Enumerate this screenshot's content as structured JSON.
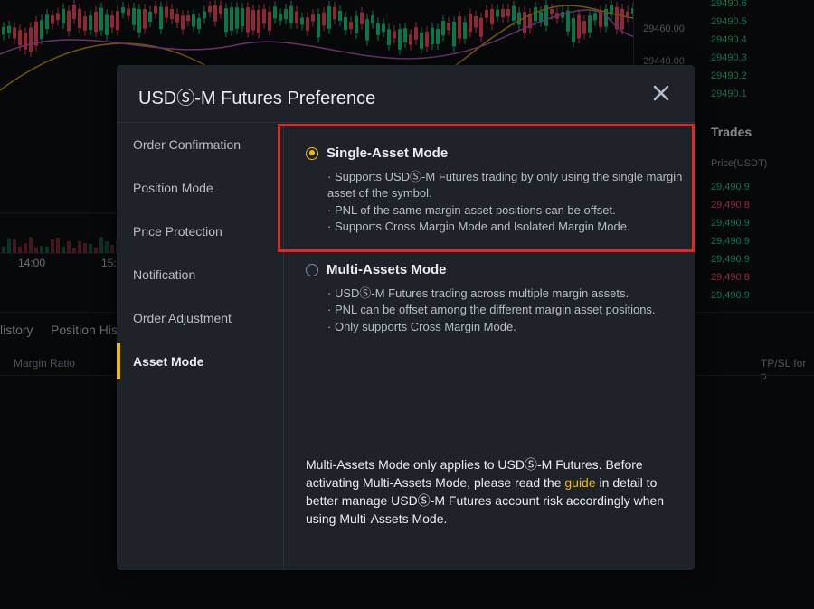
{
  "background": {
    "price_axis": [
      "29460.00",
      "29440.00"
    ],
    "orderbook_prices": [
      "29490.6",
      "29490.5",
      "29490.4",
      "29490.3",
      "29490.2",
      "29490.1"
    ],
    "trades": {
      "title": "Trades",
      "header": "Price(USDT)",
      "rows": [
        {
          "price": "29,490.9",
          "color": "#0ecb81"
        },
        {
          "price": "29,490.8",
          "color": "#f6465d"
        },
        {
          "price": "29,490.9",
          "color": "#0ecb81"
        },
        {
          "price": "29,490.9",
          "color": "#0ecb81"
        },
        {
          "price": "29,490.9",
          "color": "#0ecb81"
        },
        {
          "price": "29,490.8",
          "color": "#f6465d"
        },
        {
          "price": "29,490.9",
          "color": "#0ecb81"
        }
      ]
    },
    "time_labels": [
      "14:00",
      "15:"
    ],
    "bottom_tabs": [
      "listory",
      "Position His"
    ],
    "bottom_columns": {
      "margin_ratio": "Margin Ratio",
      "tpsl": "TP/SL for p"
    }
  },
  "modal": {
    "title": "USDⓈ-M Futures Preference",
    "close_icon": "close-icon",
    "nav": [
      {
        "label": "Order Confirmation",
        "active": false
      },
      {
        "label": "Position Mode",
        "active": false
      },
      {
        "label": "Price Protection",
        "active": false
      },
      {
        "label": "Notification",
        "active": false
      },
      {
        "label": "Order Adjustment",
        "active": false
      },
      {
        "label": "Asset Mode",
        "active": true
      }
    ],
    "options": [
      {
        "title": "Single-Asset Mode",
        "selected": true,
        "bullets": [
          "Supports USDⓈ-M Futures trading by only using the single margin asset of the symbol.",
          "PNL of the same margin asset positions can be offset.",
          "Supports Cross Margin Mode and Isolated Margin Mode."
        ]
      },
      {
        "title": "Multi-Assets Mode",
        "selected": false,
        "bullets": [
          "USDⓈ-M Futures trading across multiple margin assets.",
          "PNL can be offset among the different margin asset positions.",
          "Only supports Cross Margin Mode."
        ]
      }
    ],
    "note": {
      "before": "Multi-Assets Mode only applies to USDⓈ-M Futures. Before activating Multi-Assets Mode, please read the ",
      "link": "guide",
      "after": " in detail to better manage USDⓈ-M Futures account risk accordingly when using Multi-Assets Mode."
    }
  },
  "colors": {
    "accent": "#f0b90b",
    "highlight_border": "#e02a2a",
    "buy": "#0ecb81",
    "sell": "#f6465d"
  }
}
